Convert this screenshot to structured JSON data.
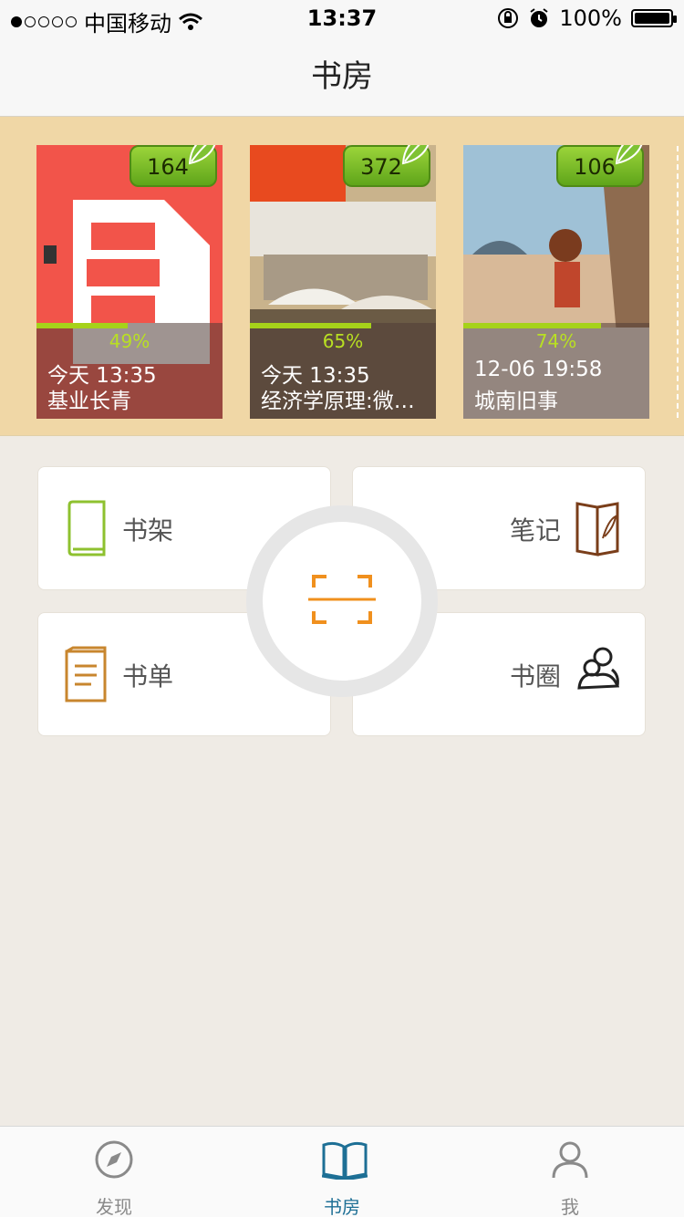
{
  "status_bar": {
    "carrier": "中国移动",
    "time": "13:37",
    "battery": "100%",
    "signal_bars": 1
  },
  "nav": {
    "title": "书房"
  },
  "recent_books": [
    {
      "count": "164",
      "progress_pct": 49,
      "progress_label": "49%",
      "time": "今天 13:35",
      "name": "基业长青",
      "cover_color": "#f2544a"
    },
    {
      "count": "372",
      "progress_pct": 65,
      "progress_label": "65%",
      "time": "今天 13:35",
      "name": "经济学原理:微观经济学分册",
      "cover_color": "#c9b38c"
    },
    {
      "count": "106",
      "progress_pct": 74,
      "progress_label": "74%",
      "time": "12-06 19:58",
      "name": "城南旧事",
      "cover_color": "#7fa7c2"
    }
  ],
  "grid": {
    "bookshelf": "书架",
    "notes": "笔记",
    "booklist": "书单",
    "circle": "书圈"
  },
  "tabs": [
    {
      "label": "发现",
      "icon": "compass-icon",
      "active": false
    },
    {
      "label": "书房",
      "icon": "open-book-icon",
      "active": true
    },
    {
      "label": "我",
      "icon": "person-icon",
      "active": false
    }
  ],
  "colors": {
    "accent_green": "#a6d21a",
    "shelf_bg": "#f0d7a6",
    "scan_orange": "#f0901e",
    "tab_active": "#1d6f95"
  }
}
